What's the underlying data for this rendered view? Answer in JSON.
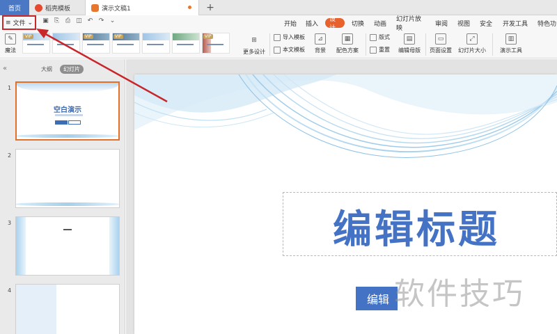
{
  "tabs": {
    "home": "首页",
    "template": "稻壳模板",
    "document": "演示文稿1",
    "add": "+"
  },
  "menu": {
    "file": "文件",
    "items": [
      "开始",
      "插入",
      "设计",
      "切换",
      "动画",
      "幻灯片放映",
      "审阅",
      "视图",
      "安全",
      "开发工具",
      "特色功"
    ],
    "active": "设计"
  },
  "ribbon": {
    "magic": "魔法",
    "more_design": "更多设计",
    "import_template": "导入模板",
    "this_template": "本文模板",
    "background": "背景",
    "color_scheme": "配色方案",
    "layout": "版式",
    "reset": "重置",
    "edit_master": "编辑母版",
    "page_setup": "页面设置",
    "slide_size": "幻灯片大小",
    "presentation_tools": "演示工具",
    "vip": "VIP"
  },
  "left_panel": {
    "outline_tab": "大纲",
    "slides_tab": "幻灯片",
    "slide_numbers": [
      "1",
      "2",
      "3",
      "4"
    ],
    "slide1_title": "空白演示"
  },
  "slide": {
    "title": "编辑标题",
    "subtitle_button": "编辑"
  },
  "watermark": "软件技巧",
  "colors": {
    "accent": "#4472c4",
    "active_tab": "#e8622c",
    "highlight_border": "#c8262a"
  }
}
